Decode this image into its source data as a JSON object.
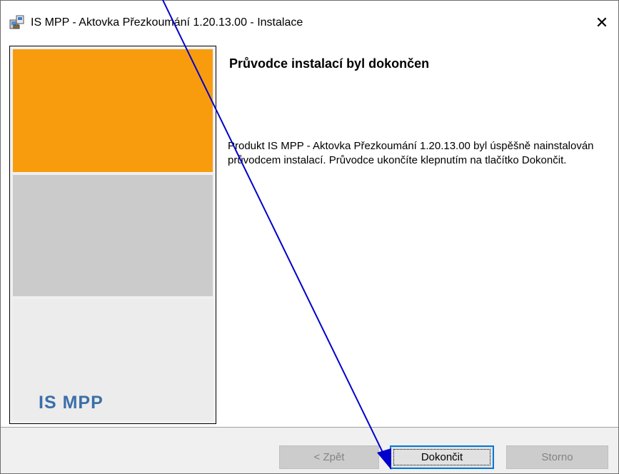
{
  "window": {
    "title": "IS MPP - Aktovka Přezkoumání 1.20.13.00 - Instalace",
    "close_glyph": "✕",
    "icon": "installer-icon"
  },
  "banner": {
    "logo_text": "IS MPP",
    "colors": {
      "orange": "#f89c0e",
      "gray": "#cbcbcb",
      "light": "#ececec",
      "logo": "#3c6fa8"
    }
  },
  "content": {
    "heading": "Průvodce instalací byl dokončen",
    "body": "Produkt IS MPP - Aktovka Přezkoumání 1.20.13.00 byl úspěšně nainstalován průvodcem instalací. Průvodce ukončíte klepnutím na tlačítko Dokončit."
  },
  "footer": {
    "back_label": "< Zpět",
    "finish_label": "Dokončit",
    "cancel_label": "Storno"
  },
  "annotation": {
    "arrow_color": "#0000cc"
  }
}
